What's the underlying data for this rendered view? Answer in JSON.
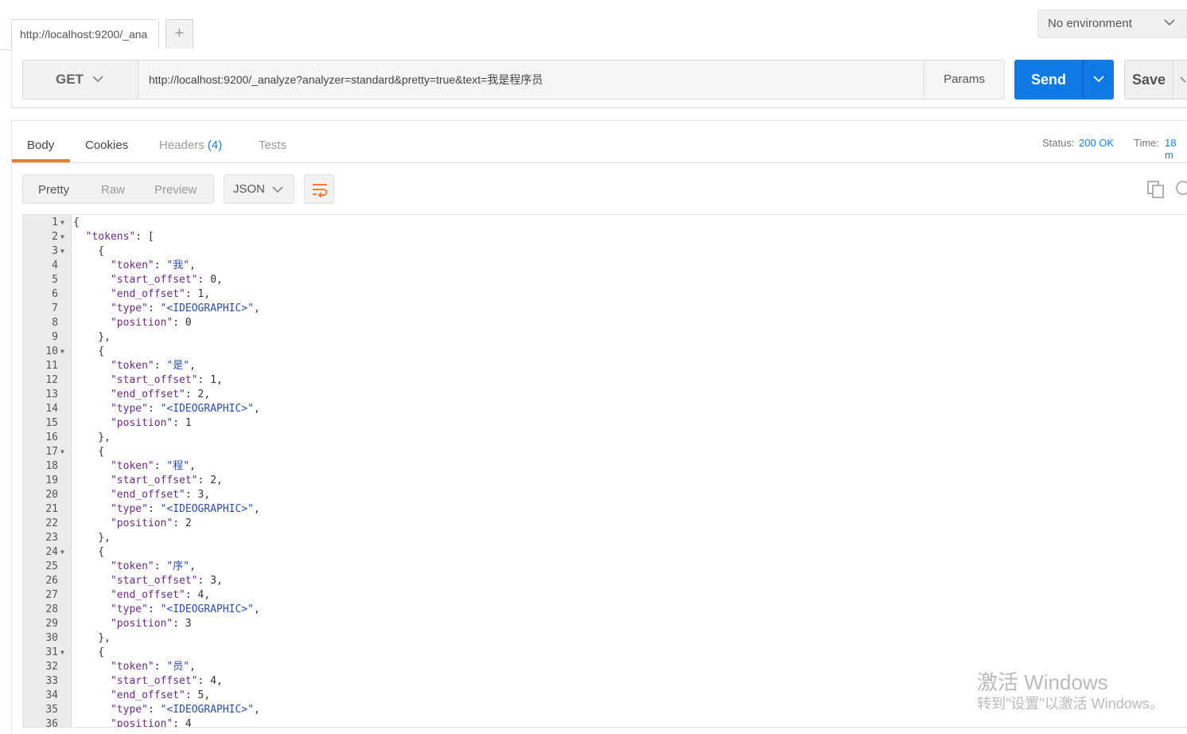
{
  "tabs": {
    "active_label": "http://localhost:9200/_ana",
    "add_label": "+"
  },
  "environment": {
    "selected": "No environment"
  },
  "request": {
    "method": "GET",
    "url": "http://localhost:9200/_analyze?analyzer=standard&pretty=true&text=我是程序员",
    "params_label": "Params",
    "send_label": "Send",
    "save_label": "Save"
  },
  "response": {
    "tabs": [
      {
        "label": "Body"
      },
      {
        "label": "Cookies"
      },
      {
        "label": "Headers",
        "count": "(4)"
      },
      {
        "label": "Tests"
      }
    ],
    "status_label": "Status:",
    "status_value": "200 OK",
    "time_label": "Time:",
    "time_value": "18 m",
    "view_modes": [
      "Pretty",
      "Raw",
      "Preview"
    ],
    "format": "JSON"
  },
  "code_lines": [
    {
      "n": "1",
      "fold": true,
      "t": "{"
    },
    {
      "n": "2",
      "fold": true,
      "t": "  \"tokens\": ["
    },
    {
      "n": "3",
      "fold": true,
      "t": "    {"
    },
    {
      "n": "4",
      "t": "      \"token\": \"我\","
    },
    {
      "n": "5",
      "t": "      \"start_offset\": 0,"
    },
    {
      "n": "6",
      "t": "      \"end_offset\": 1,"
    },
    {
      "n": "7",
      "t": "      \"type\": \"<IDEOGRAPHIC>\","
    },
    {
      "n": "8",
      "t": "      \"position\": 0"
    },
    {
      "n": "9",
      "t": "    },"
    },
    {
      "n": "10",
      "fold": true,
      "t": "    {"
    },
    {
      "n": "11",
      "t": "      \"token\": \"是\","
    },
    {
      "n": "12",
      "t": "      \"start_offset\": 1,"
    },
    {
      "n": "13",
      "t": "      \"end_offset\": 2,"
    },
    {
      "n": "14",
      "t": "      \"type\": \"<IDEOGRAPHIC>\","
    },
    {
      "n": "15",
      "t": "      \"position\": 1"
    },
    {
      "n": "16",
      "t": "    },"
    },
    {
      "n": "17",
      "fold": true,
      "t": "    {"
    },
    {
      "n": "18",
      "t": "      \"token\": \"程\","
    },
    {
      "n": "19",
      "t": "      \"start_offset\": 2,"
    },
    {
      "n": "20",
      "t": "      \"end_offset\": 3,"
    },
    {
      "n": "21",
      "t": "      \"type\": \"<IDEOGRAPHIC>\","
    },
    {
      "n": "22",
      "t": "      \"position\": 2"
    },
    {
      "n": "23",
      "t": "    },"
    },
    {
      "n": "24",
      "fold": true,
      "t": "    {"
    },
    {
      "n": "25",
      "t": "      \"token\": \"序\","
    },
    {
      "n": "26",
      "t": "      \"start_offset\": 3,"
    },
    {
      "n": "27",
      "t": "      \"end_offset\": 4,"
    },
    {
      "n": "28",
      "t": "      \"type\": \"<IDEOGRAPHIC>\","
    },
    {
      "n": "29",
      "t": "      \"position\": 3"
    },
    {
      "n": "30",
      "t": "    },"
    },
    {
      "n": "31",
      "fold": true,
      "t": "    {"
    },
    {
      "n": "32",
      "t": "      \"token\": \"员\","
    },
    {
      "n": "33",
      "t": "      \"start_offset\": 4,"
    },
    {
      "n": "34",
      "t": "      \"end_offset\": 5,"
    },
    {
      "n": "35",
      "t": "      \"type\": \"<IDEOGRAPHIC>\","
    },
    {
      "n": "36",
      "t": "      \"position\": 4"
    }
  ],
  "watermark": {
    "line1": "激活 Windows",
    "line2": "转到\"设置\"以激活 Windows。"
  },
  "colors": {
    "accent": "#0f7ae5",
    "tab_underline": "#f07a37",
    "status": "#1a7de6"
  }
}
